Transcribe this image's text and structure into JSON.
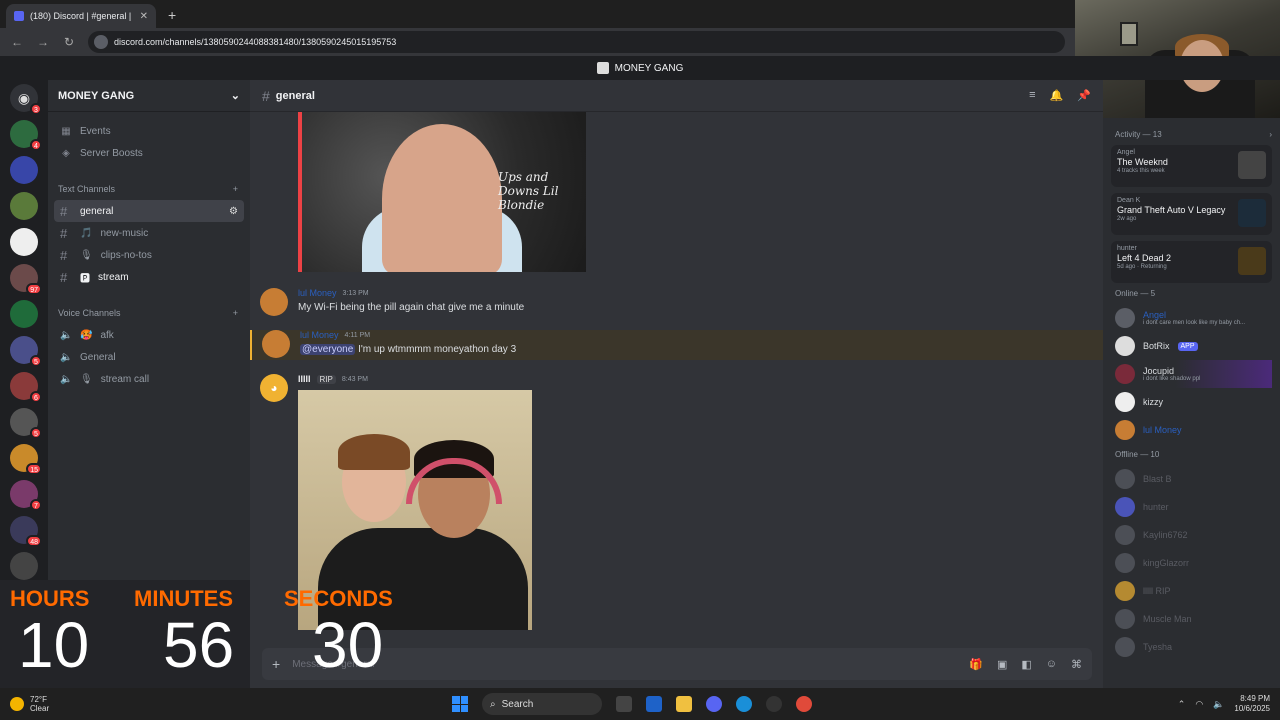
{
  "browser": {
    "tab_title": "(180) Discord | #general | M",
    "url": "discord.com/channels/1380590244088381480/1380590245015195753",
    "new_tab": "+"
  },
  "banner": {
    "server_name": "MONEY GANG"
  },
  "rail": {
    "badges": [
      "3",
      "4",
      "97",
      "5",
      "6",
      "5",
      "15",
      "7",
      "48"
    ]
  },
  "sidebar": {
    "server_name": "MONEY GANG",
    "top_items": [
      {
        "label": "Events"
      },
      {
        "label": "Server Boosts"
      }
    ],
    "text_category": "Text Channels",
    "text_channels": [
      {
        "label": "general"
      },
      {
        "label": "new-music",
        "icon": "🎵"
      },
      {
        "label": "clips-no-tos",
        "icon": "🎙"
      },
      {
        "label": "stream",
        "icon": "🅿"
      }
    ],
    "voice_category": "Voice Channels",
    "voice_channels": [
      {
        "label": "afk",
        "icon": "🥵"
      },
      {
        "label": "General"
      },
      {
        "label": "stream call",
        "icon": "🎙"
      }
    ]
  },
  "channel": {
    "name": "general",
    "embed_text": "Ups and Downs Lil Blondie",
    "messages": [
      {
        "author": "lul Money",
        "time": "3:13 PM",
        "text": "My Wi-Fi being the pill again chat give me a minute"
      },
      {
        "author": "lul Money",
        "time": "4:11 PM",
        "mention": "@everyone",
        "text": " I'm up wtmmmm moneyathon day 3"
      },
      {
        "author": "lllll",
        "tag": "RIP",
        "time": "8:43 PM"
      }
    ],
    "composer_placeholder": "Message #general"
  },
  "members": {
    "activity_title": "Activity — 13",
    "activities": [
      {
        "user": "Angel",
        "game": "The Weeknd",
        "sub": "4 tracks this week"
      },
      {
        "user": "Dean K",
        "game": "Grand Theft Auto V Legacy",
        "sub": "2w ago"
      },
      {
        "user": "hunter",
        "game": "Left 4 Dead 2",
        "sub": "5d ago · Returning"
      }
    ],
    "online_title": "Online — 5",
    "online": [
      {
        "name": "Angel",
        "status": "i dont care men look like my baby ch..."
      },
      {
        "name": "BotRix",
        "badge": "APP"
      },
      {
        "name": "Jocupid",
        "status": "i dont like shadow ppl"
      },
      {
        "name": "kizzy"
      },
      {
        "name": "lul Money"
      }
    ],
    "offline_title": "Offline — 10",
    "offline": [
      {
        "name": "Blast B"
      },
      {
        "name": "hunter"
      },
      {
        "name": "Kaylin6762"
      },
      {
        "name": "kingGlazorr"
      },
      {
        "name": "lllll  RIP"
      },
      {
        "name": "Muscle Man"
      },
      {
        "name": "Tyesha"
      }
    ]
  },
  "timer": {
    "hours_label": "HOURS",
    "hours": "10",
    "minutes_label": "MINUTES",
    "minutes": "56",
    "seconds_label": "SECONDS",
    "seconds": "30"
  },
  "taskbar": {
    "temp": "72°F",
    "weather": "Clear",
    "search": "Search",
    "time": "8:49 PM",
    "date": "10/6/2025"
  },
  "colors": {
    "accent": "#5865f2",
    "timer_label": "#ff6a00",
    "mention_bg": "#3b362a"
  }
}
